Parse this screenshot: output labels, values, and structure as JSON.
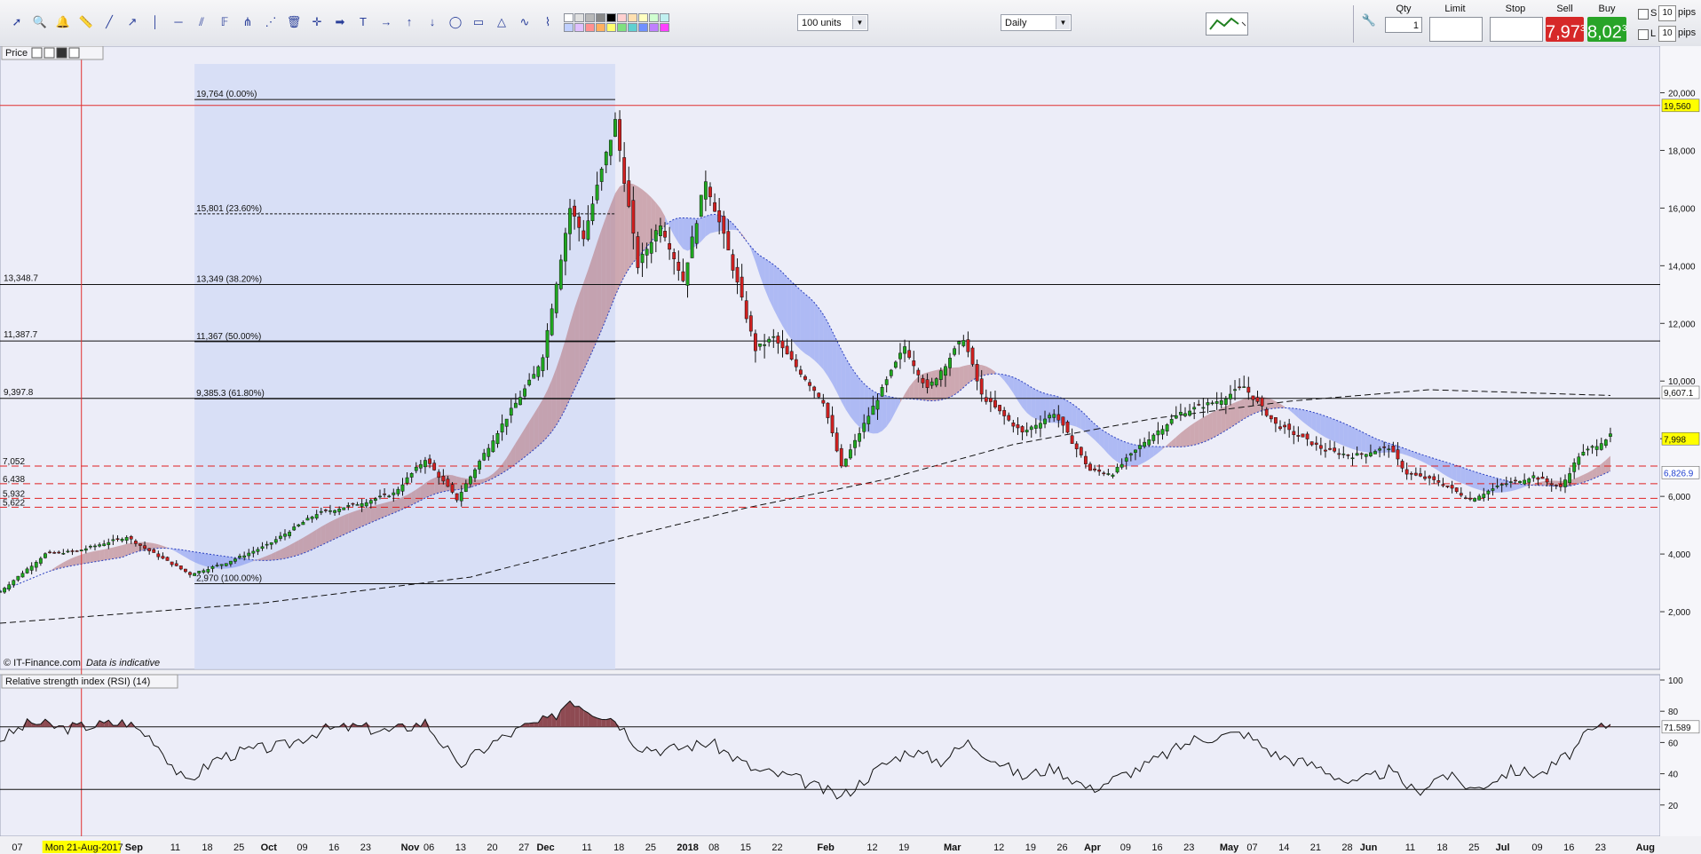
{
  "toolbar": {
    "quantity_select": "100 units",
    "interval_select": "Daily",
    "qty_label": "Qty",
    "qty_value": "1",
    "limit_label": "Limit",
    "stop_label": "Stop",
    "sell_label": "Sell",
    "buy_label": "Buy",
    "sell_price": "7,97",
    "sell_sup": "3",
    "buy_price": "8,02",
    "buy_sup": "3",
    "buy_prefix": "8",
    "pips_value": "10",
    "pips_label": "pips",
    "s_label": "S",
    "l_label": "L",
    "tool_icons": [
      "cursor-icon",
      "zoom-icon",
      "bell-icon",
      "ruler-icon",
      "trendline-icon",
      "ray-icon",
      "vertical-line-icon",
      "horizontal-line-icon",
      "channel-icon",
      "fibonacci-icon",
      "pitchfork-icon",
      "gann-fan-icon",
      "eraser-icon",
      "crosshair-icon",
      "arrow-icon",
      "text-icon",
      "arrow-right-icon",
      "arrow-up-icon",
      "arrow-down-icon",
      "ellipse-icon",
      "rectangle-icon",
      "triangle-icon",
      "wave-icon",
      "pattern-icon"
    ],
    "swatch_colors": [
      "#ffffff",
      "#e0e0e0",
      "#b8b8b8",
      "#888888",
      "#000000",
      "#ffd0d0",
      "#ffe0b0",
      "#ffffc0",
      "#d0ffd0",
      "#c0f0f0",
      "#c0d0ff",
      "#e0c0ff",
      "#ff9090",
      "#ffb060",
      "#ffff70",
      "#80e080",
      "#60d0d0",
      "#7090ff",
      "#c080ff",
      "#ff40ff"
    ]
  },
  "chart_data": {
    "type": "candlestick",
    "instrument": "Price",
    "pane_title": "Price",
    "footer_left": "© IT-Finance.com",
    "footer_note": "Data is indicative",
    "colors": {
      "up": "#1fa81f",
      "down": "#d02020",
      "cloud_bull": "#b56f76",
      "cloud_bear": "#7b8ff0",
      "pane_bg": "#ecedf8",
      "fib_bg": "#d3dbf5",
      "accent": "#ffff00"
    },
    "ylim": [
      0,
      21000
    ],
    "y_ticks": [
      "2,000",
      "4,000",
      "6,000",
      "8,000",
      "10,000",
      "12,000",
      "14,000",
      "16,000",
      "18,000",
      "20,000"
    ],
    "y_tick_values": [
      2000,
      4000,
      6000,
      8000,
      10000,
      12000,
      14000,
      16000,
      18000,
      20000
    ],
    "x_labels": [
      {
        "d": "2017-08-07",
        "t": "07"
      },
      {
        "d": "2017-08-21",
        "t": "Mon 21-Aug-2017",
        "highlight": true
      },
      {
        "d": "2017-09-01",
        "t": "Sep",
        "bold": true
      },
      {
        "d": "2017-09-11",
        "t": "11"
      },
      {
        "d": "2017-09-18",
        "t": "18"
      },
      {
        "d": "2017-09-25",
        "t": "25"
      },
      {
        "d": "2017-10-01",
        "t": "Oct",
        "bold": true
      },
      {
        "d": "2017-10-09",
        "t": "09"
      },
      {
        "d": "2017-10-16",
        "t": "16"
      },
      {
        "d": "2017-10-23",
        "t": "23"
      },
      {
        "d": "2017-11-01",
        "t": "Nov",
        "bold": true
      },
      {
        "d": "2017-11-06",
        "t": "06"
      },
      {
        "d": "2017-11-13",
        "t": "13"
      },
      {
        "d": "2017-11-20",
        "t": "20"
      },
      {
        "d": "2017-11-27",
        "t": "27"
      },
      {
        "d": "2017-12-01",
        "t": "Dec",
        "bold": true
      },
      {
        "d": "2017-12-11",
        "t": "11"
      },
      {
        "d": "2017-12-18",
        "t": "18"
      },
      {
        "d": "2017-12-25",
        "t": "25"
      },
      {
        "d": "2018-01-01",
        "t": "2018",
        "bold": true
      },
      {
        "d": "2018-01-08",
        "t": "08"
      },
      {
        "d": "2018-01-15",
        "t": "15"
      },
      {
        "d": "2018-01-22",
        "t": "22"
      },
      {
        "d": "2018-02-01",
        "t": "Feb",
        "bold": true
      },
      {
        "d": "2018-02-12",
        "t": "12"
      },
      {
        "d": "2018-02-19",
        "t": "19"
      },
      {
        "d": "2018-03-01",
        "t": "Mar",
        "bold": true
      },
      {
        "d": "2018-03-12",
        "t": "12"
      },
      {
        "d": "2018-03-19",
        "t": "19"
      },
      {
        "d": "2018-03-26",
        "t": "26"
      },
      {
        "d": "2018-04-01",
        "t": "Apr",
        "bold": true
      },
      {
        "d": "2018-04-09",
        "t": "09"
      },
      {
        "d": "2018-04-16",
        "t": "16"
      },
      {
        "d": "2018-04-23",
        "t": "23"
      },
      {
        "d": "2018-05-01",
        "t": "May",
        "bold": true
      },
      {
        "d": "2018-05-07",
        "t": "07"
      },
      {
        "d": "2018-05-14",
        "t": "14"
      },
      {
        "d": "2018-05-21",
        "t": "21"
      },
      {
        "d": "2018-05-28",
        "t": "28"
      },
      {
        "d": "2018-06-01",
        "t": "Jun",
        "bold": true
      },
      {
        "d": "2018-06-11",
        "t": "11"
      },
      {
        "d": "2018-06-18",
        "t": "18"
      },
      {
        "d": "2018-06-25",
        "t": "25"
      },
      {
        "d": "2018-07-01",
        "t": "Jul",
        "bold": true
      },
      {
        "d": "2018-07-09",
        "t": "09"
      },
      {
        "d": "2018-07-16",
        "t": "16"
      },
      {
        "d": "2018-07-23",
        "t": "23"
      },
      {
        "d": "2018-08-01",
        "t": "Aug",
        "bold": true
      }
    ],
    "x_range": [
      "2017-08-03",
      "2018-08-05"
    ],
    "vline_date": "2017-08-21",
    "fib_range": {
      "from_date": "2017-09-15",
      "to_date": "2017-12-17",
      "high": 19764,
      "low": 2970
    },
    "fib_levels": [
      {
        "value": 19764,
        "label": "19,764 (0.00%)"
      },
      {
        "value": 15801,
        "label": "15,801 (23.60%)",
        "dashed": true
      },
      {
        "value": 13349,
        "label": "13,349 (38.20%)"
      },
      {
        "value": 11367,
        "label": "11,367 (50.00%)"
      },
      {
        "value": 9385.3,
        "label": "9,385.3 (61.80%)"
      },
      {
        "value": 2970,
        "label": "2,970 (100.00%)"
      }
    ],
    "h_lines": [
      {
        "value": 13348.7,
        "label": "13,348.7"
      },
      {
        "value": 11387.7,
        "label": "11,387.7"
      },
      {
        "value": 9397.8,
        "label": "9,397.8"
      }
    ],
    "dashed_levels": [
      {
        "value": 7052,
        "label": "7,052"
      },
      {
        "value": 6438,
        "label": "6,438"
      },
      {
        "value": 5932,
        "label": "5,932"
      },
      {
        "value": 5622,
        "label": "5,622"
      }
    ],
    "red_line": {
      "value": 19560,
      "label": "19,560"
    },
    "axis_badges": [
      {
        "value": 9607.1,
        "label": "9,607.1",
        "style": "plain"
      },
      {
        "value": 7998,
        "label": "7,998",
        "style": "yellow"
      },
      {
        "value": 6826.9,
        "label": "6,826.9",
        "style": "blue"
      }
    ],
    "ohlc_anchors": [
      [
        "2017-08-03",
        2700
      ],
      [
        "2017-08-13",
        4000
      ],
      [
        "2017-08-20",
        4100
      ],
      [
        "2017-08-31",
        4600
      ],
      [
        "2017-09-04",
        4200
      ],
      [
        "2017-09-14",
        3300
      ],
      [
        "2017-09-22",
        3700
      ],
      [
        "2017-10-01",
        4300
      ],
      [
        "2017-10-12",
        5400
      ],
      [
        "2017-10-20",
        5700
      ],
      [
        "2017-10-29",
        6100
      ],
      [
        "2017-11-05",
        7300
      ],
      [
        "2017-11-12",
        5900
      ],
      [
        "2017-11-20",
        8000
      ],
      [
        "2017-11-29",
        10200
      ],
      [
        "2017-12-01",
        10900
      ],
      [
        "2017-12-07",
        16000
      ],
      [
        "2017-12-10",
        15000
      ],
      [
        "2017-12-17",
        19000
      ],
      [
        "2017-12-22",
        14000
      ],
      [
        "2017-12-27",
        15500
      ],
      [
        "2018-01-01",
        13500
      ],
      [
        "2018-01-06",
        17000
      ],
      [
        "2018-01-11",
        14500
      ],
      [
        "2018-01-17",
        11100
      ],
      [
        "2018-01-21",
        11500
      ],
      [
        "2018-02-01",
        9300
      ],
      [
        "2018-02-05",
        7000
      ],
      [
        "2018-02-10",
        8500
      ],
      [
        "2018-02-19",
        11200
      ],
      [
        "2018-02-24",
        9700
      ],
      [
        "2018-03-04",
        11500
      ],
      [
        "2018-03-08",
        9500
      ],
      [
        "2018-03-17",
        8200
      ],
      [
        "2018-03-24",
        8900
      ],
      [
        "2018-04-01",
        6900
      ],
      [
        "2018-04-06",
        6800
      ],
      [
        "2018-04-13",
        7900
      ],
      [
        "2018-04-21",
        8900
      ],
      [
        "2018-04-29",
        9300
      ],
      [
        "2018-05-05",
        9800
      ],
      [
        "2018-05-12",
        8500
      ],
      [
        "2018-05-23",
        7600
      ],
      [
        "2018-05-29",
        7400
      ],
      [
        "2018-06-06",
        7700
      ],
      [
        "2018-06-10",
        6800
      ],
      [
        "2018-06-17",
        6500
      ],
      [
        "2018-06-24",
        5900
      ],
      [
        "2018-07-01",
        6400
      ],
      [
        "2018-07-08",
        6700
      ],
      [
        "2018-07-14",
        6300
      ],
      [
        "2018-07-18",
        7400
      ],
      [
        "2018-07-25",
        8100
      ]
    ],
    "ma200_anchors": [
      [
        "2017-08-03",
        1600
      ],
      [
        "2017-09-30",
        2300
      ],
      [
        "2017-11-15",
        3200
      ],
      [
        "2017-12-17",
        4500
      ],
      [
        "2018-01-15",
        5600
      ],
      [
        "2018-02-15",
        6600
      ],
      [
        "2018-03-15",
        7800
      ],
      [
        "2018-04-15",
        8700
      ],
      [
        "2018-05-15",
        9300
      ],
      [
        "2018-06-15",
        9700
      ],
      [
        "2018-07-25",
        9500
      ]
    ],
    "rsi": {
      "title": "Relative strength index (RSI) (14)",
      "ylim": [
        0,
        100
      ],
      "y_ticks": [
        "20",
        "40",
        "60",
        "80",
        "100"
      ],
      "y_tick_values": [
        20,
        40,
        60,
        80,
        100
      ],
      "overbought": 70,
      "oversold": 30,
      "last_label": "71.589",
      "anchors": [
        [
          "2017-08-03",
          62
        ],
        [
          "2017-08-10",
          73
        ],
        [
          "2017-08-17",
          69
        ],
        [
          "2017-08-24",
          71
        ],
        [
          "2017-08-31",
          73
        ],
        [
          "2017-09-06",
          62
        ],
        [
          "2017-09-13",
          34
        ],
        [
          "2017-09-20",
          50
        ],
        [
          "2017-09-27",
          55
        ],
        [
          "2017-10-05",
          58
        ],
        [
          "2017-10-13",
          68
        ],
        [
          "2017-10-21",
          70
        ],
        [
          "2017-10-28",
          67
        ],
        [
          "2017-11-05",
          73
        ],
        [
          "2017-11-10",
          55
        ],
        [
          "2017-11-12",
          44
        ],
        [
          "2017-11-20",
          60
        ],
        [
          "2017-11-27",
          70
        ],
        [
          "2017-12-03",
          75
        ],
        [
          "2017-12-07",
          88
        ],
        [
          "2017-12-12",
          80
        ],
        [
          "2017-12-17",
          75
        ],
        [
          "2017-12-22",
          58
        ],
        [
          "2017-12-28",
          55
        ],
        [
          "2018-01-07",
          60
        ],
        [
          "2018-01-17",
          42
        ],
        [
          "2018-01-25",
          38
        ],
        [
          "2018-02-05",
          25
        ],
        [
          "2018-02-14",
          45
        ],
        [
          "2018-02-20",
          55
        ],
        [
          "2018-02-27",
          48
        ],
        [
          "2018-03-05",
          60
        ],
        [
          "2018-03-17",
          38
        ],
        [
          "2018-03-24",
          44
        ],
        [
          "2018-04-01",
          30
        ],
        [
          "2018-04-13",
          45
        ],
        [
          "2018-04-24",
          62
        ],
        [
          "2018-05-05",
          66
        ],
        [
          "2018-05-12",
          52
        ],
        [
          "2018-05-22",
          44
        ],
        [
          "2018-05-29",
          33
        ],
        [
          "2018-06-06",
          42
        ],
        [
          "2018-06-12",
          28
        ],
        [
          "2018-06-18",
          40
        ],
        [
          "2018-06-25",
          30
        ],
        [
          "2018-07-03",
          42
        ],
        [
          "2018-07-10",
          40
        ],
        [
          "2018-07-17",
          55
        ],
        [
          "2018-07-20",
          66
        ],
        [
          "2018-07-25",
          72
        ]
      ]
    }
  }
}
